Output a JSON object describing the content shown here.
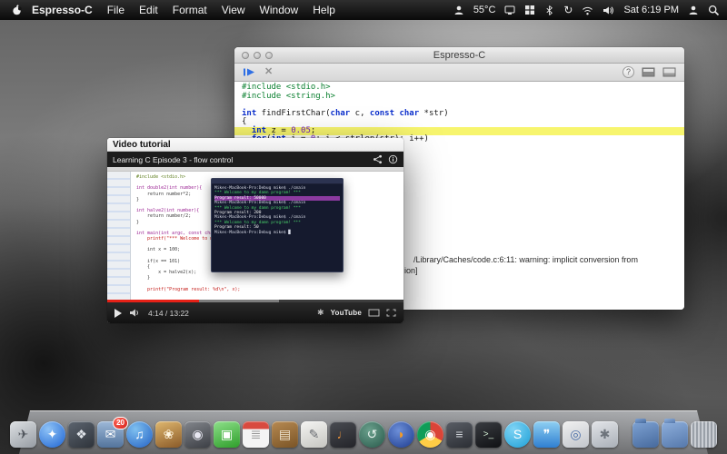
{
  "menu_bar": {
    "app_name": "Espresso-C",
    "items": [
      "File",
      "Edit",
      "Format",
      "View",
      "Window",
      "Help"
    ],
    "temperature": "55°C",
    "clock": "Sat 6:19 PM",
    "status_icon_names": [
      "user-menu-icon",
      "display-menu-icon",
      "keyboard-menu-icon",
      "bluetooth-menu-icon",
      "sync-menu-icon",
      "wifi-menu-icon",
      "volume-menu-icon",
      "fast-user-switch-icon",
      "spotlight-icon"
    ]
  },
  "editor_window": {
    "title": "Espresso-C",
    "toolbar": {
      "help_label": "?",
      "stop_glyph": "✕",
      "icon_names": [
        "run-icon",
        "stop-icon",
        "help-icon",
        "console-panel-icon",
        "editor-panel-icon"
      ]
    },
    "colors": {
      "highlight_line": "#f7f56e",
      "keyword": "#0a2ecc",
      "preprocessor": "#0b8030"
    },
    "code_lines": [
      {
        "seg": [
          {
            "t": "#include <stdio.h>",
            "c": "pp"
          }
        ]
      },
      {
        "seg": [
          {
            "t": "#include <string.h>",
            "c": "pp"
          }
        ]
      },
      {
        "seg": [
          {
            "t": " ",
            "c": "plain"
          }
        ]
      },
      {
        "seg": [
          {
            "t": "int",
            "c": "kw"
          },
          {
            "t": " findFirstChar(",
            "c": "plain"
          },
          {
            "t": "char",
            "c": "kw"
          },
          {
            "t": " c, ",
            "c": "plain"
          },
          {
            "t": "const",
            "c": "kw"
          },
          {
            "t": " ",
            "c": "plain"
          },
          {
            "t": "char",
            "c": "kw"
          },
          {
            "t": " *str)",
            "c": "plain"
          }
        ]
      },
      {
        "seg": [
          {
            "t": "{",
            "c": "plain"
          }
        ]
      },
      {
        "hl": true,
        "seg": [
          {
            "t": "  ",
            "c": "plain"
          },
          {
            "t": "int",
            "c": "kw"
          },
          {
            "t": " z = ",
            "c": "plain"
          },
          {
            "t": "0.05",
            "c": "num"
          },
          {
            "t": ";",
            "c": "plain"
          }
        ]
      },
      {
        "seg": [
          {
            "t": "  ",
            "c": "plain"
          },
          {
            "t": "for",
            "c": "kw"
          },
          {
            "t": "(",
            "c": "plain"
          },
          {
            "t": "int",
            "c": "kw"
          },
          {
            "t": " i = ",
            "c": "plain"
          },
          {
            "t": "0",
            "c": "num"
          },
          {
            "t": "; i < strlen(str); i++)",
            "c": "plain"
          }
        ]
      },
      {
        "seg": [
          {
            "t": "  {",
            "c": "plain"
          }
        ]
      }
    ],
    "output_lines": [
      "/Library/Caches/code.c:6:11: warning: implicit conversion from",
      "ion]"
    ]
  },
  "video_window": {
    "title": "Video tutorial",
    "player": {
      "header_title": "Learning C Episode 3 - flow control",
      "time": "4:14 / 13:22",
      "logo": "YouTube",
      "settings_glyph": "✱",
      "progress_percent": 31,
      "buffered_percent": 58,
      "code_lines": [
        {
          "t": "#include <stdio.h>",
          "c": "pp"
        },
        {
          "t": " ",
          "c": "plain"
        },
        {
          "t": "int double2(int number){",
          "c": "kw"
        },
        {
          "t": "    return number*2;",
          "c": "plain"
        },
        {
          "t": "}",
          "c": "plain"
        },
        {
          "t": " ",
          "c": "plain"
        },
        {
          "t": "int halve2(int number){",
          "c": "kw"
        },
        {
          "t": "    return number/2;",
          "c": "plain"
        },
        {
          "t": "}",
          "c": "plain"
        },
        {
          "t": " ",
          "c": "plain"
        },
        {
          "t": "int main(int argc, const char * argv[]) {",
          "c": "kw"
        },
        {
          "t": "    printf(\"*** Welcome to my damn program! ***\\n\");",
          "c": "str"
        },
        {
          "t": " ",
          "c": "plain"
        },
        {
          "t": "    int x = 100;",
          "c": "plain"
        },
        {
          "t": " ",
          "c": "plain"
        },
        {
          "t": "    if(x == 101)",
          "c": "plain"
        },
        {
          "t": "    {",
          "c": "plain"
        },
        {
          "t": "        x = halve2(x);",
          "c": "plain"
        },
        {
          "t": "    }",
          "c": "plain"
        },
        {
          "t": " ",
          "c": "plain"
        },
        {
          "t": "    printf(\"Program result: %d\\n\", x);",
          "c": "str"
        }
      ],
      "terminal_lines": [
        {
          "t": "Mikes-MacBook-Pro:Debug mike$ ./cmain",
          "c": "prompt"
        },
        {
          "t": "*** Welcome to my damn program! ***",
          "c": "green"
        },
        {
          "t": "Program result: 50000",
          "c": "sel"
        },
        {
          "t": "Mikes-MacBook-Pro:Debug mike$ ./cmain",
          "c": "prompt"
        },
        {
          "t": "*** Welcome to my damn program! ***",
          "c": "green"
        },
        {
          "t": "Program result: 200",
          "c": "white"
        },
        {
          "t": "Mikes-MacBook-Pro:Debug mike$ ./cmain",
          "c": "prompt"
        },
        {
          "t": "*** Welcome to my damn program! ***",
          "c": "green"
        },
        {
          "t": "Program result: 50",
          "c": "white"
        },
        {
          "t": "Mikes-MacBook-Pro:Debug mike$ ▉",
          "c": "prompt"
        }
      ]
    }
  },
  "dock": {
    "items": [
      {
        "type": "app",
        "name": "launchpad",
        "glyph": "✈",
        "fg": "#50555c",
        "bg": "linear-gradient(150deg,#dde0e3,#969ca3)"
      },
      {
        "type": "app",
        "name": "safari",
        "glyph": "✦",
        "fg": "#ffffff",
        "bg": "radial-gradient(circle at 35% 30%,#8fc3f7,#1d63d1)",
        "cls": "round"
      },
      {
        "type": "app",
        "name": "xcode",
        "glyph": "❖",
        "fg": "#dfe3e8",
        "bg": "linear-gradient(150deg,#5d6570,#2e333a)"
      },
      {
        "type": "app",
        "name": "mail",
        "glyph": "✉",
        "fg": "#ffffff",
        "bg": "linear-gradient(180deg,#9db8d8,#53749c)",
        "badge": "20"
      },
      {
        "type": "app",
        "name": "itunes",
        "glyph": "♫",
        "fg": "#ffffff",
        "bg": "radial-gradient(circle at 35% 30%,#7fc0f0,#2361c4)",
        "cls": "round"
      },
      {
        "type": "app",
        "name": "iphoto",
        "glyph": "❀",
        "fg": "#fff6e0",
        "bg": "linear-gradient(160deg,#e0b86f,#8a5a28)"
      },
      {
        "type": "app",
        "name": "photo-booth",
        "glyph": "◉",
        "fg": "#e8e8f2",
        "bg": "linear-gradient(160deg,#83868c,#3c3f45)"
      },
      {
        "type": "app",
        "name": "facetime",
        "glyph": "▣",
        "fg": "#ffffff",
        "bg": "linear-gradient(160deg,#8ee08a,#2f9e2b)"
      },
      {
        "type": "app",
        "name": "calendar",
        "glyph": "≣",
        "fg": "#9a9a9a",
        "bg": "linear-gradient(180deg,#d84a3f 0%,#d84a3f 30%,#f4f4f4 30%)"
      },
      {
        "type": "app",
        "name": "contacts",
        "glyph": "▤",
        "fg": "#f0e6d2",
        "bg": "linear-gradient(160deg,#b78a52,#7a5426)"
      },
      {
        "type": "app",
        "name": "textedit",
        "glyph": "✎",
        "fg": "#6b6e73",
        "bg": "linear-gradient(160deg,#f4f4f2,#c6c6c1)"
      },
      {
        "type": "app",
        "name": "garageband",
        "glyph": "♩",
        "fg": "#e8923a",
        "bg": "linear-gradient(160deg,#4a4c52,#232429)"
      },
      {
        "type": "app",
        "name": "time-machine",
        "glyph": "↺",
        "fg": "#e8f2ee",
        "bg": "radial-gradient(circle at 40% 35%,#6aa08c,#27584a)",
        "cls": "round"
      },
      {
        "type": "app",
        "name": "firefox",
        "glyph": "◗",
        "fg": "#f59a23",
        "bg": "radial-gradient(circle at 40% 35%,#6d8fd8,#1b3a8f)",
        "cls": "round"
      },
      {
        "type": "app",
        "name": "chrome",
        "glyph": "◉",
        "fg": "#ffffff",
        "bg": "conic-gradient(#db4437 0% 33%,#ffcd46 33% 66%,#0f9d58 66% 100%)",
        "cls": "round"
      },
      {
        "type": "app",
        "name": "calculator",
        "glyph": "≡",
        "fg": "#cfd3d8",
        "bg": "linear-gradient(160deg,#5a5e66,#2b2e34)"
      },
      {
        "type": "app",
        "name": "terminal",
        "glyph": ">_",
        "fg": "#cfe8cf",
        "bg": "linear-gradient(160deg,#3a3d42,#101114)"
      },
      {
        "type": "app",
        "name": "skype",
        "glyph": "S",
        "fg": "#ffffff",
        "bg": "radial-gradient(circle at 35% 30%,#7fd4f5,#1d9fd6)",
        "cls": "round"
      },
      {
        "type": "app",
        "name": "messages",
        "glyph": "❞",
        "fg": "#ffffff",
        "bg": "linear-gradient(180deg,#8fd0f2,#2f7fd1)"
      },
      {
        "type": "app",
        "name": "preview",
        "glyph": "◎",
        "fg": "#4a6ea8",
        "bg": "linear-gradient(160deg,#f0f0f0,#c2c6cc)"
      },
      {
        "type": "app",
        "name": "system-preferences",
        "glyph": "✱",
        "fg": "#6e747c",
        "bg": "linear-gradient(160deg,#e2e4e8,#aab0b8)"
      },
      {
        "type": "separator",
        "name": "dock-separator"
      },
      {
        "type": "app",
        "name": "downloads-folder",
        "glyph": "",
        "fg": "#ffffff",
        "bg": "linear-gradient(160deg,#7fa3d4,#46699c)",
        "cls": "folder"
      },
      {
        "type": "app",
        "name": "documents-folder",
        "glyph": "",
        "fg": "#ffffff",
        "bg": "linear-gradient(160deg,#8fb0dd,#5578ab)",
        "cls": "folder"
      },
      {
        "type": "app",
        "name": "trash",
        "glyph": "",
        "fg": "#666666",
        "bg": "repeating-linear-gradient(90deg,#caced4 0px,#caced4 2px,#9aa0a8 2px,#9aa0a8 4px)"
      }
    ]
  }
}
